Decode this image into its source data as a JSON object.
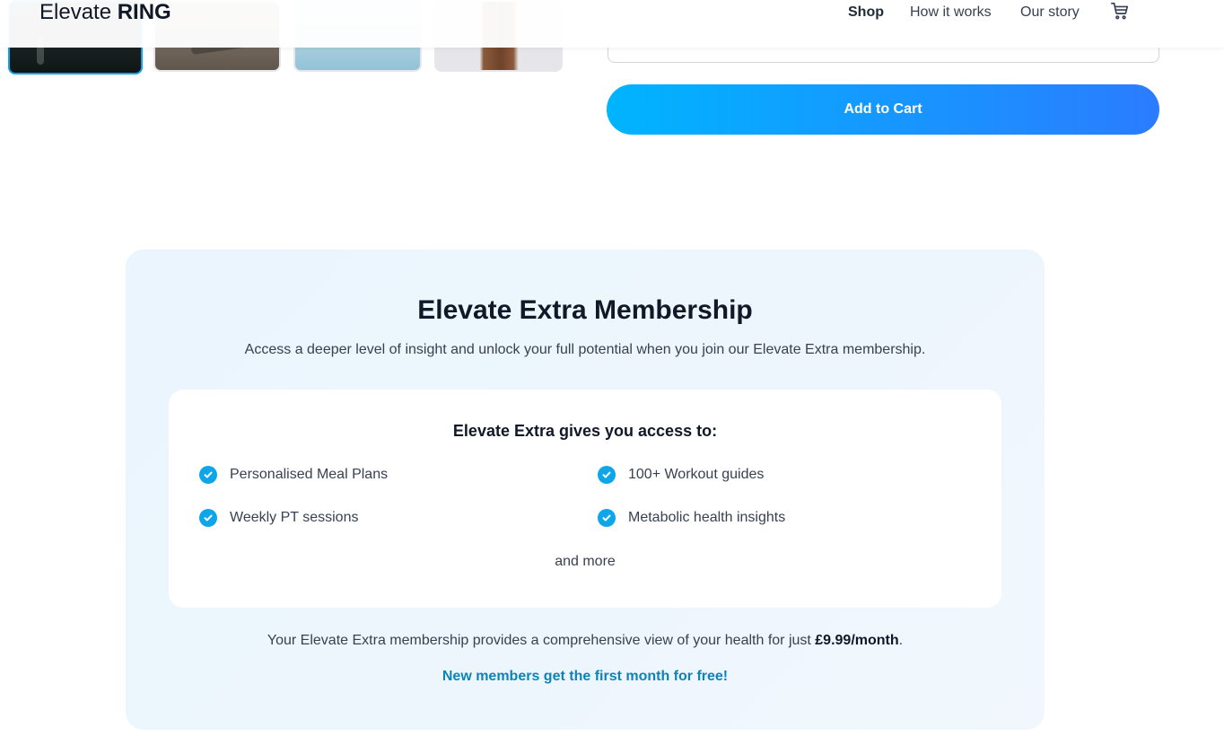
{
  "header": {
    "logo_light": "Elevate ",
    "logo_bold": "RING",
    "nav": {
      "shop": "Shop",
      "how_it_works": "How it works",
      "our_story": "Our story"
    },
    "cart_icon": "cart-icon"
  },
  "product": {
    "add_to_cart_label": "Add to Cart"
  },
  "membership": {
    "title": "Elevate Extra Membership",
    "subtitle": "Access a deeper level of insight and unlock your full potential when you join our Elevate Extra membership.",
    "access_heading": "Elevate Extra gives you access to:",
    "benefits": [
      "Personalised Meal Plans",
      "100+ Workout guides",
      "Weekly PT sessions",
      "Metabolic health insights"
    ],
    "and_more": "and more",
    "price_text": "Your Elevate Extra membership provides a comprehensive view of your health for just ",
    "price_value": "£9.99/month",
    "price_end": ".",
    "promo": "New members get the first month for free!"
  },
  "colors": {
    "accent": "#0ea5e9",
    "button_gradient_start": "#00b4ff",
    "button_gradient_end": "#2b7cff",
    "promo_text": "#0b84b8",
    "card_background": "#eaf5fd"
  }
}
